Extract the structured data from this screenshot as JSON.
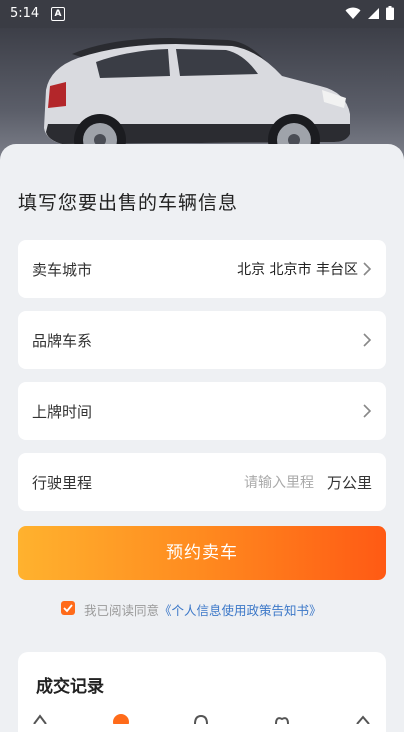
{
  "status_bar": {
    "time": "5:14",
    "a_badge": "A"
  },
  "page_title": "填写您要出售的车辆信息",
  "form": {
    "city": {
      "label": "卖车城市",
      "value": "北京 北京市 丰台区"
    },
    "brand": {
      "label": "品牌车系"
    },
    "reg_date": {
      "label": "上牌时间"
    },
    "mileage": {
      "label": "行驶里程",
      "placeholder": "请输入里程",
      "unit": "万公里"
    }
  },
  "submit_button": {
    "label": "预约卖车"
  },
  "agreement": {
    "text": "我已阅读同意",
    "link": "《个人信息使用政策告知书》",
    "checked": true
  },
  "records": {
    "title": "成交记录"
  },
  "colors": {
    "accent": "#ff6b1a",
    "link": "#3c78c8"
  }
}
